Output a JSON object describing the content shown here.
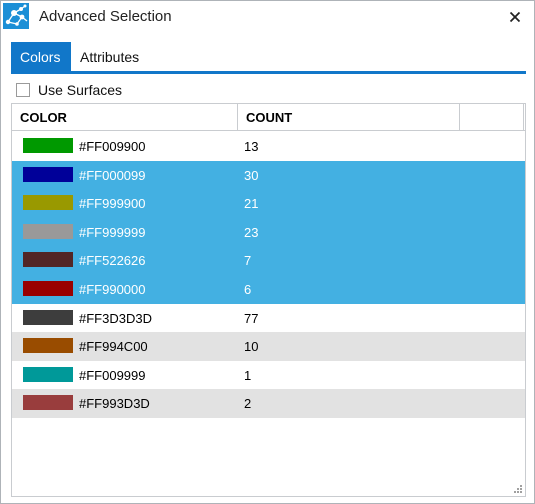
{
  "window": {
    "title": "Advanced Selection",
    "close_icon": "close-icon"
  },
  "tabs": [
    {
      "label": "Colors",
      "active": true
    },
    {
      "label": "Attributes",
      "active": false
    }
  ],
  "use_surfaces": {
    "label": "Use Surfaces",
    "checked": false
  },
  "grid": {
    "columns": [
      "COLOR",
      "COUNT"
    ],
    "rows": [
      {
        "hex": "#FF009900",
        "count": "13",
        "swatch": "#009900",
        "state": "normal"
      },
      {
        "hex": "#FF000099",
        "count": "30",
        "swatch": "#000099",
        "state": "selected"
      },
      {
        "hex": "#FF999900",
        "count": "21",
        "swatch": "#999900",
        "state": "selected"
      },
      {
        "hex": "#FF999999",
        "count": "23",
        "swatch": "#999999",
        "state": "selected"
      },
      {
        "hex": "#FF522626",
        "count": "7",
        "swatch": "#522626",
        "state": "selected"
      },
      {
        "hex": "#FF990000",
        "count": "6",
        "swatch": "#990000",
        "state": "selected"
      },
      {
        "hex": "#FF3D3D3D",
        "count": "77",
        "swatch": "#3d3d3d",
        "state": "normal"
      },
      {
        "hex": "#FF994C00",
        "count": "10",
        "swatch": "#994c00",
        "state": "alt"
      },
      {
        "hex": "#FF009999",
        "count": "1",
        "swatch": "#009999",
        "state": "normal"
      },
      {
        "hex": "#FF993D3D",
        "count": "2",
        "swatch": "#993d3d",
        "state": "alt"
      }
    ]
  },
  "colors": {
    "accent": "#1177c9",
    "selection": "#43b0e2",
    "alt_row": "#e2e2e2"
  }
}
